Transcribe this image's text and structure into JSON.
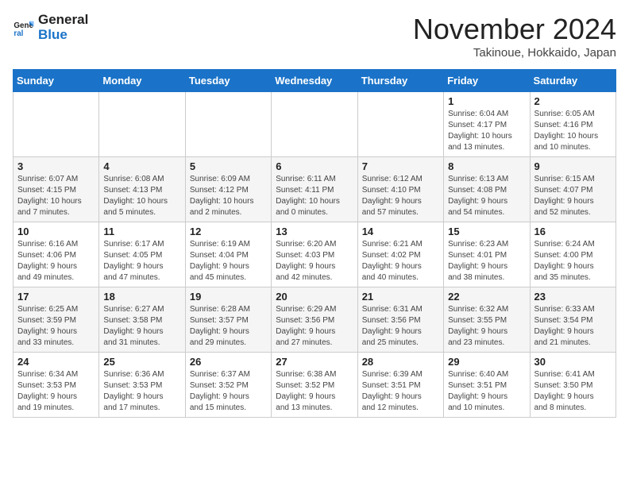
{
  "header": {
    "logo_line1": "General",
    "logo_line2": "Blue",
    "month": "November 2024",
    "location": "Takinoue, Hokkaido, Japan"
  },
  "days_of_week": [
    "Sunday",
    "Monday",
    "Tuesday",
    "Wednesday",
    "Thursday",
    "Friday",
    "Saturday"
  ],
  "weeks": [
    [
      {
        "day": "",
        "info": ""
      },
      {
        "day": "",
        "info": ""
      },
      {
        "day": "",
        "info": ""
      },
      {
        "day": "",
        "info": ""
      },
      {
        "day": "",
        "info": ""
      },
      {
        "day": "1",
        "info": "Sunrise: 6:04 AM\nSunset: 4:17 PM\nDaylight: 10 hours\nand 13 minutes."
      },
      {
        "day": "2",
        "info": "Sunrise: 6:05 AM\nSunset: 4:16 PM\nDaylight: 10 hours\nand 10 minutes."
      }
    ],
    [
      {
        "day": "3",
        "info": "Sunrise: 6:07 AM\nSunset: 4:15 PM\nDaylight: 10 hours\nand 7 minutes."
      },
      {
        "day": "4",
        "info": "Sunrise: 6:08 AM\nSunset: 4:13 PM\nDaylight: 10 hours\nand 5 minutes."
      },
      {
        "day": "5",
        "info": "Sunrise: 6:09 AM\nSunset: 4:12 PM\nDaylight: 10 hours\nand 2 minutes."
      },
      {
        "day": "6",
        "info": "Sunrise: 6:11 AM\nSunset: 4:11 PM\nDaylight: 10 hours\nand 0 minutes."
      },
      {
        "day": "7",
        "info": "Sunrise: 6:12 AM\nSunset: 4:10 PM\nDaylight: 9 hours\nand 57 minutes."
      },
      {
        "day": "8",
        "info": "Sunrise: 6:13 AM\nSunset: 4:08 PM\nDaylight: 9 hours\nand 54 minutes."
      },
      {
        "day": "9",
        "info": "Sunrise: 6:15 AM\nSunset: 4:07 PM\nDaylight: 9 hours\nand 52 minutes."
      }
    ],
    [
      {
        "day": "10",
        "info": "Sunrise: 6:16 AM\nSunset: 4:06 PM\nDaylight: 9 hours\nand 49 minutes."
      },
      {
        "day": "11",
        "info": "Sunrise: 6:17 AM\nSunset: 4:05 PM\nDaylight: 9 hours\nand 47 minutes."
      },
      {
        "day": "12",
        "info": "Sunrise: 6:19 AM\nSunset: 4:04 PM\nDaylight: 9 hours\nand 45 minutes."
      },
      {
        "day": "13",
        "info": "Sunrise: 6:20 AM\nSunset: 4:03 PM\nDaylight: 9 hours\nand 42 minutes."
      },
      {
        "day": "14",
        "info": "Sunrise: 6:21 AM\nSunset: 4:02 PM\nDaylight: 9 hours\nand 40 minutes."
      },
      {
        "day": "15",
        "info": "Sunrise: 6:23 AM\nSunset: 4:01 PM\nDaylight: 9 hours\nand 38 minutes."
      },
      {
        "day": "16",
        "info": "Sunrise: 6:24 AM\nSunset: 4:00 PM\nDaylight: 9 hours\nand 35 minutes."
      }
    ],
    [
      {
        "day": "17",
        "info": "Sunrise: 6:25 AM\nSunset: 3:59 PM\nDaylight: 9 hours\nand 33 minutes."
      },
      {
        "day": "18",
        "info": "Sunrise: 6:27 AM\nSunset: 3:58 PM\nDaylight: 9 hours\nand 31 minutes."
      },
      {
        "day": "19",
        "info": "Sunrise: 6:28 AM\nSunset: 3:57 PM\nDaylight: 9 hours\nand 29 minutes."
      },
      {
        "day": "20",
        "info": "Sunrise: 6:29 AM\nSunset: 3:56 PM\nDaylight: 9 hours\nand 27 minutes."
      },
      {
        "day": "21",
        "info": "Sunrise: 6:31 AM\nSunset: 3:56 PM\nDaylight: 9 hours\nand 25 minutes."
      },
      {
        "day": "22",
        "info": "Sunrise: 6:32 AM\nSunset: 3:55 PM\nDaylight: 9 hours\nand 23 minutes."
      },
      {
        "day": "23",
        "info": "Sunrise: 6:33 AM\nSunset: 3:54 PM\nDaylight: 9 hours\nand 21 minutes."
      }
    ],
    [
      {
        "day": "24",
        "info": "Sunrise: 6:34 AM\nSunset: 3:53 PM\nDaylight: 9 hours\nand 19 minutes."
      },
      {
        "day": "25",
        "info": "Sunrise: 6:36 AM\nSunset: 3:53 PM\nDaylight: 9 hours\nand 17 minutes."
      },
      {
        "day": "26",
        "info": "Sunrise: 6:37 AM\nSunset: 3:52 PM\nDaylight: 9 hours\nand 15 minutes."
      },
      {
        "day": "27",
        "info": "Sunrise: 6:38 AM\nSunset: 3:52 PM\nDaylight: 9 hours\nand 13 minutes."
      },
      {
        "day": "28",
        "info": "Sunrise: 6:39 AM\nSunset: 3:51 PM\nDaylight: 9 hours\nand 12 minutes."
      },
      {
        "day": "29",
        "info": "Sunrise: 6:40 AM\nSunset: 3:51 PM\nDaylight: 9 hours\nand 10 minutes."
      },
      {
        "day": "30",
        "info": "Sunrise: 6:41 AM\nSunset: 3:50 PM\nDaylight: 9 hours\nand 8 minutes."
      }
    ]
  ]
}
